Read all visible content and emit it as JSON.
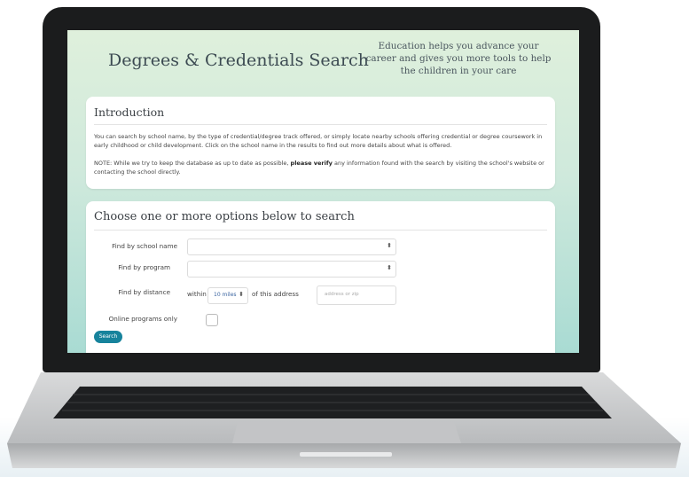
{
  "header": {
    "title": "Degrees & Credentials Search",
    "tagline": "Education helps you advance your career and gives you more tools to help the children in your care"
  },
  "intro": {
    "heading": "Introduction",
    "paragraph1": "You can search by school name, by the type of credential/degree track offered, or simply locate nearby schools offering credential or degree coursework in early childhood or child development. Click on the school name in the results to find out more details about what is offered.",
    "paragraph2_before": "NOTE: While we try to keep the database as up to date as possible, ",
    "paragraph2_bold": "please verify",
    "paragraph2_after": " any information found with the search by visiting the school's website or contacting the school directly."
  },
  "search": {
    "heading": "Choose one or more options below to search",
    "school_label": "Find by school name",
    "program_label": "Find by program",
    "distance_label": "Find by distance",
    "within_text": "within",
    "miles_value": "10 miles",
    "of_address_text": "of this address",
    "address_placeholder": "address or zip",
    "online_label": "Online programs only",
    "button_label": "Search"
  },
  "colors": {
    "accent": "#17839c",
    "laptop_bezel": "#1b1c1d"
  },
  "icons": {
    "select_caret": "up-down-caret-icon"
  }
}
